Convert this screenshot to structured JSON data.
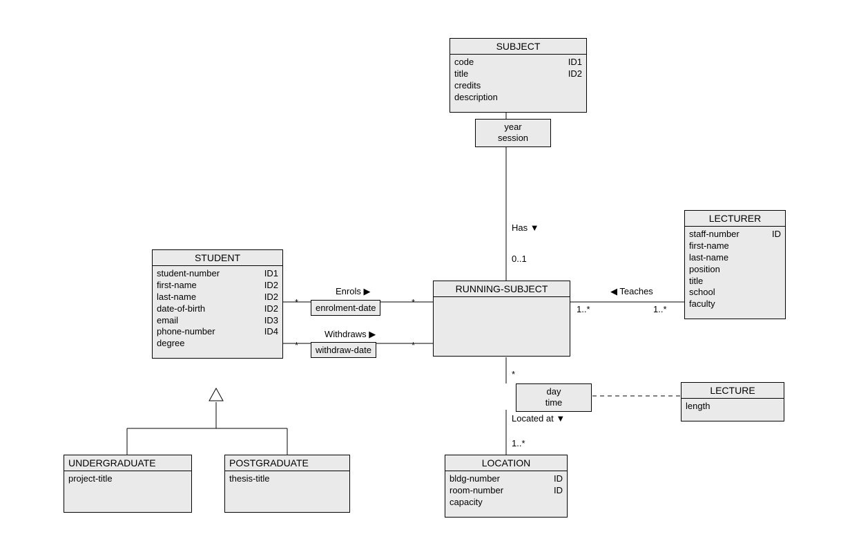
{
  "entities": {
    "subject": {
      "name": "SUBJECT",
      "attrs": [
        {
          "name": "code",
          "id": "ID1"
        },
        {
          "name": "title",
          "id": "ID2"
        },
        {
          "name": "credits",
          "id": ""
        },
        {
          "name": "description",
          "id": ""
        }
      ]
    },
    "student": {
      "name": "STUDENT",
      "attrs": [
        {
          "name": "student-number",
          "id": "ID1"
        },
        {
          "name": "first-name",
          "id": "ID2"
        },
        {
          "name": "last-name",
          "id": "ID2"
        },
        {
          "name": "date-of-birth",
          "id": "ID2"
        },
        {
          "name": "email",
          "id": "ID3"
        },
        {
          "name": "phone-number",
          "id": "ID4"
        },
        {
          "name": "degree",
          "id": ""
        }
      ]
    },
    "running_subject": {
      "name": "RUNNING-SUBJECT"
    },
    "lecturer": {
      "name": "LECTURER",
      "attrs": [
        {
          "name": "staff-number",
          "id": "ID"
        },
        {
          "name": "first-name",
          "id": ""
        },
        {
          "name": "last-name",
          "id": ""
        },
        {
          "name": "position",
          "id": ""
        },
        {
          "name": "title",
          "id": ""
        },
        {
          "name": "school",
          "id": ""
        },
        {
          "name": "faculty",
          "id": ""
        }
      ]
    },
    "undergraduate": {
      "name": "UNDERGRADUATE",
      "attrs": [
        {
          "name": "project-title",
          "id": ""
        }
      ]
    },
    "postgraduate": {
      "name": "POSTGRADUATE",
      "attrs": [
        {
          "name": "thesis-title",
          "id": ""
        }
      ]
    },
    "location": {
      "name": "LOCATION",
      "attrs": [
        {
          "name": "bldg-number",
          "id": "ID"
        },
        {
          "name": "room-number",
          "id": "ID"
        },
        {
          "name": "capacity",
          "id": ""
        }
      ]
    },
    "lecture": {
      "name": "LECTURE",
      "attrs": [
        {
          "name": "length",
          "id": ""
        }
      ]
    }
  },
  "assoc_classes": {
    "subject_running": [
      "year",
      "session"
    ],
    "day_time": [
      "day",
      "time"
    ]
  },
  "assoc_labels": {
    "enrols_title": "Enrols ▶",
    "enrols_attr": "enrolment-date",
    "withdraws_title": "Withdraws ▶",
    "withdraws_attr": "withdraw-date"
  },
  "rel_labels": {
    "has": "Has ▼",
    "teaches": "◀ Teaches",
    "located_at": "Located at ▼"
  },
  "mults": {
    "has_bottom": "0..1",
    "enrols_left": "*",
    "enrols_right": "*",
    "withdraws_left": "*",
    "withdraws_right": "*",
    "teaches_left": "1..*",
    "teaches_right": "1..*",
    "day_time_top": "*",
    "located_at_bottom": "1..*"
  }
}
